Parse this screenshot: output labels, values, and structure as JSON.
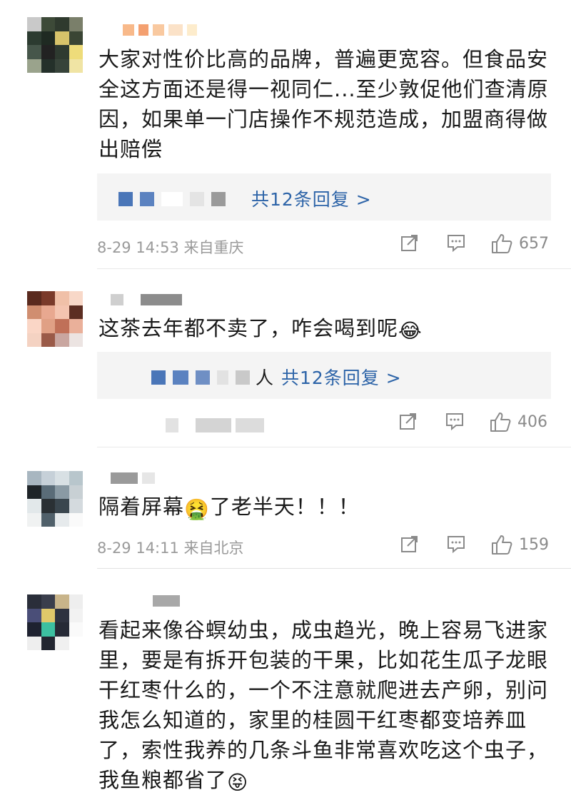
{
  "comments": [
    {
      "text": "大家对性价比高的品牌，普遍更宽容。但食品安全这方面还是得一视同仁...至少敦促他们查清原因，如果单一门店操作不规范造成，加盟商得做出赔偿",
      "reply_link": "共12条回复 >",
      "time": "8-29 14:53",
      "location": "来自重庆",
      "likes": "657"
    },
    {
      "text": "这茶去年都不卖了，咋会喝到呢",
      "emoji": "😂",
      "reply_prefix": "人",
      "reply_link": "共12条回复 >",
      "likes": "406"
    },
    {
      "text": "隔着屏幕",
      "emoji": "🤮",
      "text_after": "了老半天！！！",
      "time": "8-29 14:11",
      "location": "来自北京",
      "likes": "159"
    },
    {
      "text": "看起来像谷螟幼虫，成虫趋光，晚上容易飞进家里，要是有拆开包装的干果，比如花生瓜子龙眼干红枣什么的，一个不注意就爬进去产卵，别问我怎么知道的，家里的桂圆干红枣都变培养皿了，索性我养的几条斗鱼非常喜欢吃这个虫子，我鱼粮都省了",
      "emoji": "😝"
    }
  ],
  "icons": [
    "share-icon",
    "comment-icon",
    "like-icon"
  ],
  "colors": {
    "link": "#2d64a8",
    "meta": "#9a9a9a",
    "reply_bg": "#f4f4f4"
  }
}
